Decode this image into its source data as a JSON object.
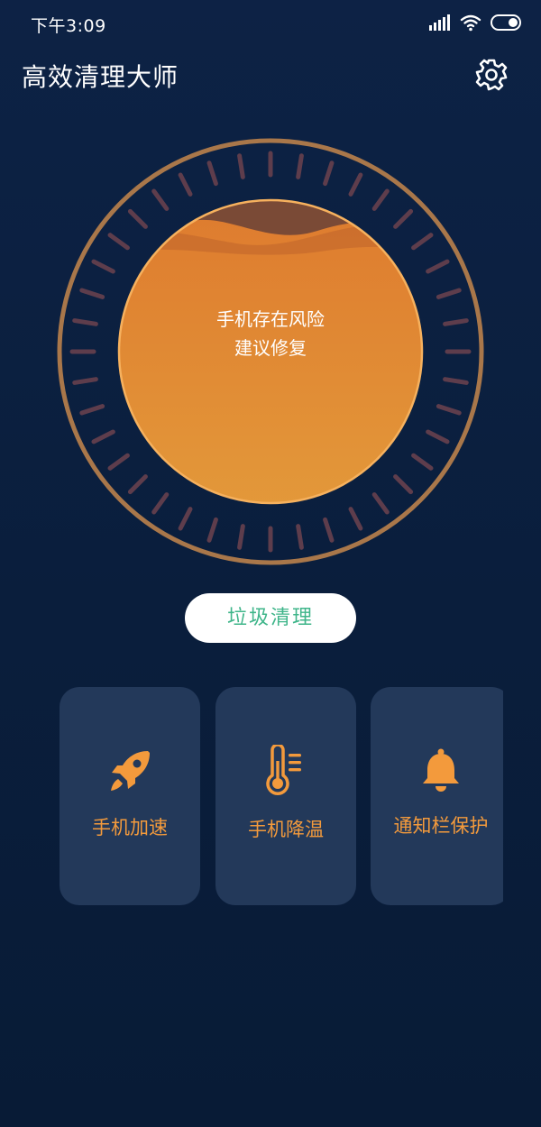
{
  "status_bar": {
    "time": "下午3:09"
  },
  "header": {
    "title": "高效清理大师"
  },
  "dial": {
    "line1": "手机存在风险",
    "line2": "建议修复"
  },
  "main_action": {
    "label": "垃圾清理"
  },
  "features": [
    {
      "label": "手机加速",
      "icon": "rocket-icon"
    },
    {
      "label": "手机降温",
      "icon": "thermometer-icon"
    },
    {
      "label": "通知栏保护",
      "icon": "bell-icon"
    }
  ],
  "colors": {
    "background": "#0b1f3e",
    "card": "#23395a",
    "accent_orange": "#f39a3c",
    "action_green": "#3fb58a",
    "ring": "#a9774a"
  }
}
